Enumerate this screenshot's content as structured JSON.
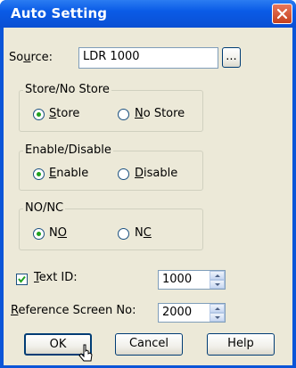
{
  "window": {
    "title": "Auto Setting"
  },
  "source": {
    "label": "Source:",
    "value": "LDR 1000",
    "browse_label": "..."
  },
  "store_group": {
    "label": "Store/No Store",
    "options": [
      "Store",
      "No Store"
    ],
    "selected": "Store"
  },
  "enable_group": {
    "label": "Enable/Disable",
    "options": [
      "Enable",
      "Disable"
    ],
    "selected": "Enable"
  },
  "nonc_group": {
    "label": "NO/NC",
    "options": [
      "NO",
      "NC"
    ],
    "selected": "NO"
  },
  "text_id": {
    "label": "Text ID:",
    "checked": true,
    "value": "1000"
  },
  "reference_screen": {
    "label": "Reference Screen No:",
    "value": "2000"
  },
  "buttons": {
    "ok": "OK",
    "cancel": "Cancel",
    "help": "Help"
  },
  "colors": {
    "titlebar": "#0a5be6",
    "dialog_bg": "#ece9d8",
    "close_button": "#c5411d",
    "radio_dot": "#21a121"
  },
  "icons": {
    "close": "close-icon",
    "cursor": "mouse-pointer-icon"
  }
}
